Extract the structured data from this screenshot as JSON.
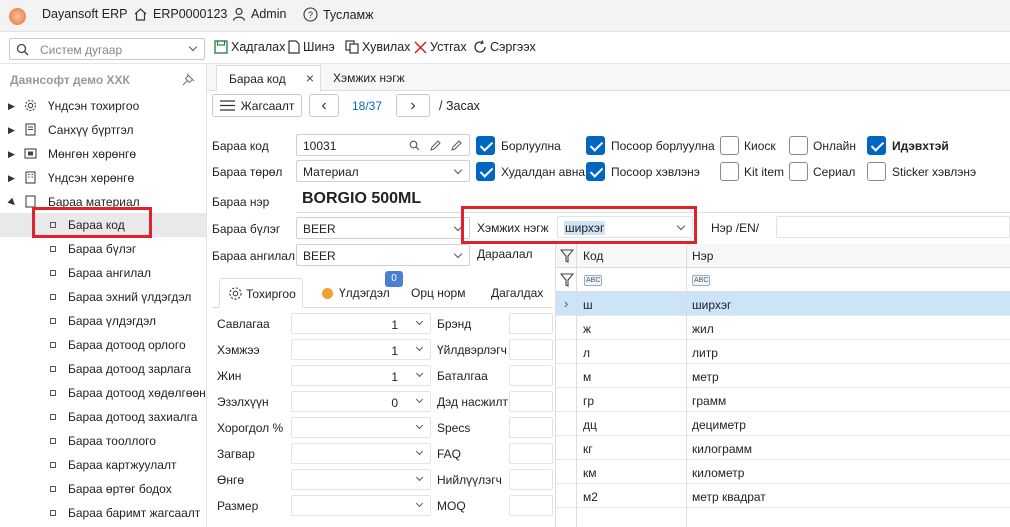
{
  "titlebar": {
    "app_name": "Dayansoft ERP",
    "code": "ERP0000123",
    "user": "Admin",
    "help": "Тусламж"
  },
  "search": {
    "placeholder": "Систем дугаар"
  },
  "toolbar": {
    "save": "Хадгалах",
    "new": "Шинэ",
    "copy": "Хувилах",
    "delete": "Устгах",
    "refresh": "Сэргээх"
  },
  "sidebar": {
    "company": "Даянсофт демо ХХК",
    "items": [
      {
        "label": "Үндсэн тохиргоо"
      },
      {
        "label": "Санхүү бүртгэл"
      },
      {
        "label": "Мөнгөн хөрөнгө"
      },
      {
        "label": "Үндсэн хөрөнгө"
      },
      {
        "label": "Бараа материал"
      }
    ],
    "subitems": [
      {
        "label": "Бараа код"
      },
      {
        "label": "Бараа бүлэг"
      },
      {
        "label": "Бараа ангилал"
      },
      {
        "label": "Бараа эхний үлдэгдэл"
      },
      {
        "label": "Бараа үлдэгдэл"
      },
      {
        "label": "Бараа дотоод орлого"
      },
      {
        "label": "Бараа дотоод зарлага"
      },
      {
        "label": "Бараа дотоод хөдөлгөөн"
      },
      {
        "label": "Бараа дотоод захиалга"
      },
      {
        "label": "Бараа тооллого"
      },
      {
        "label": "Бараа картжуулалт"
      },
      {
        "label": "Бараа өртөг бодох"
      },
      {
        "label": "Бараа баримт жагсаалт"
      }
    ]
  },
  "tabs": {
    "active": "Бараа код",
    "second": "Хэмжих нэгж"
  },
  "nav": {
    "list": "Жагсаалт",
    "page": "18/37",
    "mode": "/ Засах"
  },
  "form": {
    "code_label": "Бараа код",
    "code_value": "10031",
    "type_label": "Бараа төрөл",
    "type_value": "Материал",
    "name_label": "Бараа нэр",
    "name_value": "BORGIO 500ML",
    "group_label": "Бараа бүлэг",
    "group_value": "BEER",
    "class_label": "Бараа ангилал",
    "class_value": "BEER",
    "unit_label": "Хэмжих нэгж",
    "unit_value": "ширхэг",
    "name_en_label": "Нэр /EN/",
    "sort_label": "Дараалал"
  },
  "checks": {
    "sell": "Борлуулна",
    "pos_sell": "Посоор борлуулна",
    "kiosk": "Киоск",
    "online": "Онлайн",
    "active": "Идэвхтэй",
    "buy": "Худалдан авна",
    "pos_use": "Посоор хэвлэнэ",
    "kit": "Kit item",
    "serial": "Сериал",
    "sticker": "Sticker хэвлэнэ"
  },
  "subtabs": {
    "settings": "Тохиргоо",
    "balance": "Үлдэгдэл",
    "badge": "0",
    "bom": "Орц норм",
    "deps": "Дагалдах"
  },
  "settings_grid": [
    {
      "label": "Савлагаа",
      "value": "1",
      "label2": "Брэнд"
    },
    {
      "label": "Хэмжээ",
      "value": "1",
      "label2": "Үйлдвэрлэгч"
    },
    {
      "label": "Жин",
      "value": "1",
      "label2": "Баталгаа"
    },
    {
      "label": "Эзэлхүүн",
      "value": "0",
      "label2": "Дэд насжилт"
    },
    {
      "label": "Хорогдол %",
      "value": "",
      "label2": "Specs"
    },
    {
      "label": "Загвар",
      "value": "",
      "label2": "FAQ"
    },
    {
      "label": "Өнгө",
      "value": "",
      "label2": "Нийлүүлэгч"
    },
    {
      "label": "Размер",
      "value": "",
      "label2": "MOQ"
    }
  ],
  "dropdown": {
    "col_code": "Код",
    "col_name": "Нэр",
    "rows": [
      {
        "code": "ш",
        "name": "ширхэг"
      },
      {
        "code": "ж",
        "name": "жил"
      },
      {
        "code": "л",
        "name": "литр"
      },
      {
        "code": "м",
        "name": "метр"
      },
      {
        "code": "гр",
        "name": "грамм"
      },
      {
        "code": "дц",
        "name": "дециметр"
      },
      {
        "code": "кг",
        "name": "килограмм"
      },
      {
        "code": "км",
        "name": "километр"
      },
      {
        "code": "м2",
        "name": "метр квадрат"
      }
    ]
  }
}
